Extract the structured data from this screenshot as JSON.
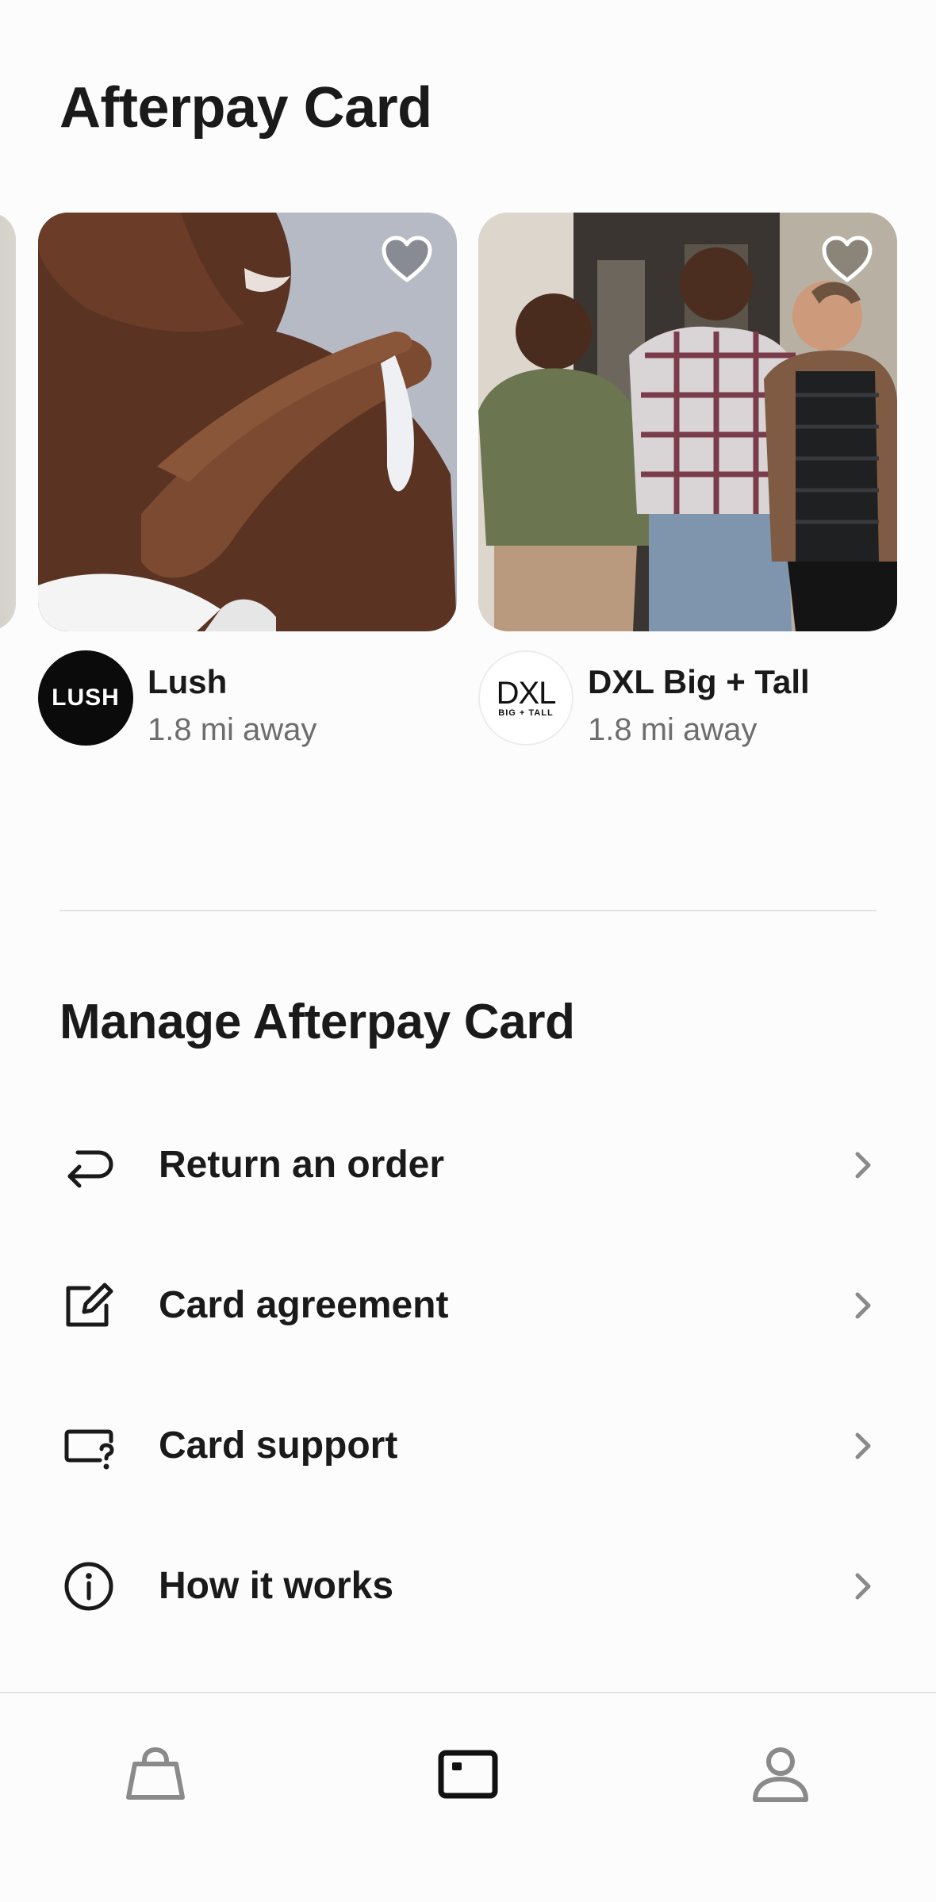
{
  "header": {
    "title": "Afterpay Card"
  },
  "stores": [
    {
      "name": "Lush",
      "distance": "1.8 mi away",
      "logo_text": "LUSH",
      "favorited": false
    },
    {
      "name": "DXL Big + Tall",
      "distance": "1.8 mi away",
      "logo_text": "DXL",
      "logo_subtext": "BIG + TALL",
      "favorited": false
    }
  ],
  "manage": {
    "title": "Manage Afterpay Card",
    "items": [
      {
        "label": "Return an order",
        "icon": "return-arrow-icon"
      },
      {
        "label": "Card agreement",
        "icon": "edit-square-icon"
      },
      {
        "label": "Card support",
        "icon": "card-question-icon"
      },
      {
        "label": "How it works",
        "icon": "info-circle-icon"
      }
    ]
  },
  "bottom_nav": {
    "items": [
      {
        "icon": "shopping-bag-icon",
        "active": false
      },
      {
        "icon": "card-icon",
        "active": true
      },
      {
        "icon": "profile-icon",
        "active": false
      }
    ]
  },
  "colors": {
    "text": "#1a1a1a",
    "muted": "#6d6d6d",
    "inactive_icon": "#8a8a8a",
    "divider": "#e3e3e3"
  }
}
